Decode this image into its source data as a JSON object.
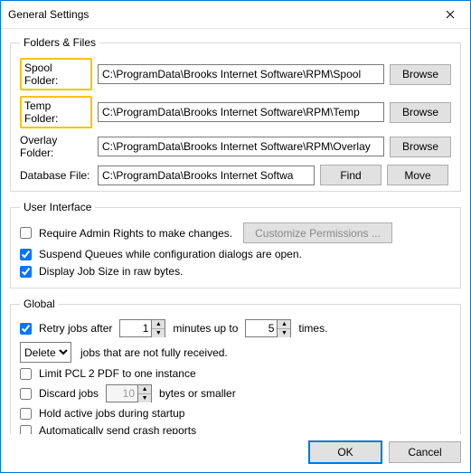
{
  "window": {
    "title": "General Settings"
  },
  "folders": {
    "legend": "Folders & Files",
    "spool": {
      "label": "Spool Folder:",
      "value": "C:\\ProgramData\\Brooks Internet Software\\RPM\\Spool",
      "btn": "Browse"
    },
    "temp": {
      "label": "Temp Folder:",
      "value": "C:\\ProgramData\\Brooks Internet Software\\RPM\\Temp",
      "btn": "Browse"
    },
    "overlay": {
      "label": "Overlay Folder:",
      "value": "C:\\ProgramData\\Brooks Internet Software\\RPM\\Overlay",
      "btn": "Browse"
    },
    "db": {
      "label": "Database File:",
      "value": "C:\\ProgramData\\Brooks Internet Softwa",
      "find": "Find",
      "move": "Move"
    }
  },
  "ui": {
    "legend": "User Interface",
    "require_admin": "Require Admin Rights to make changes.",
    "customize": "Customize Permissions ...",
    "suspend": "Suspend Queues while configuration dialogs are open.",
    "jobsize": "Display Job Size in raw bytes."
  },
  "global": {
    "legend": "Global",
    "retry_before": "Retry jobs after",
    "retry_val1": "1",
    "retry_mid": "minutes up to",
    "retry_val2": "5",
    "retry_after": "times.",
    "action": "Delete",
    "action_text": "jobs that are not fully received.",
    "limit_pcl": "Limit PCL 2 PDF to one instance",
    "discard": "Discard jobs",
    "discard_val": "10",
    "discard_after": "bytes or smaller",
    "hold": "Hold active jobs during startup",
    "crash": "Automatically send crash reports"
  },
  "footer": {
    "ok": "OK",
    "cancel": "Cancel"
  }
}
